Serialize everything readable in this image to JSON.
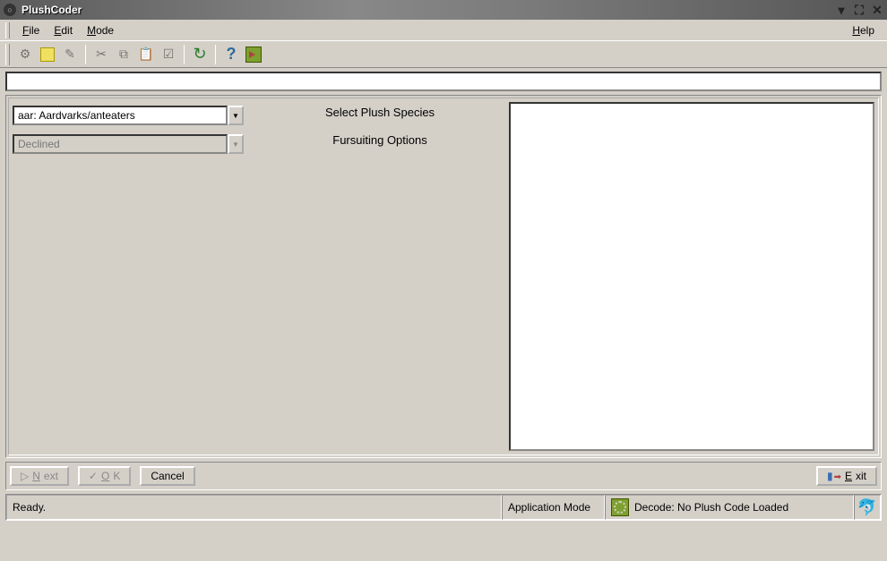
{
  "window": {
    "title": "PlushCoder"
  },
  "menubar": {
    "file": "File",
    "edit": "Edit",
    "mode": "Mode",
    "help": "Help"
  },
  "toolbar": {
    "items": [
      "new-icon",
      "save-icon",
      "wizard-icon",
      "cut-icon",
      "copy-icon",
      "paste-icon",
      "check-icon",
      "refresh-icon",
      "help-icon",
      "pointer-icon"
    ]
  },
  "main": {
    "species_dropdown": "aar: Aardvarks/anteaters",
    "fursuit_dropdown": "Declined",
    "species_label": "Select Plush Species",
    "fursuit_label": "Fursuiting Options"
  },
  "buttons": {
    "next": "Next",
    "ok": "OK",
    "cancel": "Cancel",
    "exit": "Exit"
  },
  "statusbar": {
    "ready": "Ready.",
    "mode_label": "Application Mode",
    "decode": "Decode: No Plush Code Loaded"
  }
}
